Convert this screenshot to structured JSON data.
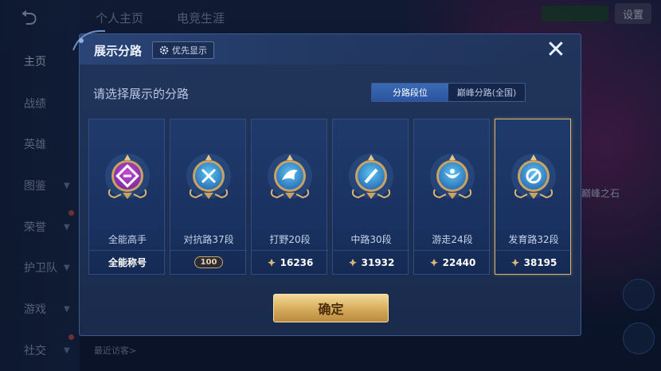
{
  "background": {
    "top_tabs": [
      "个人主页",
      "电竞生涯"
    ],
    "settings_label": "设置",
    "nav_items": [
      "主页",
      "战绩",
      "英雄",
      "图鉴",
      "荣誉",
      "护卫队",
      "游戏",
      "社交"
    ],
    "visitors_label": "最近访客>",
    "right_side_label": "巅峰之石"
  },
  "modal": {
    "title": "展示分路",
    "pref_button_label": "优先显示",
    "close_label": "✕",
    "prompt": "请选择展示的分路",
    "tabs": [
      {
        "label": "分路段位",
        "active": true
      },
      {
        "label": "巅峰分路(全国)",
        "active": false
      }
    ],
    "cards": [
      {
        "label": "全能高手",
        "footer": "全能称号",
        "footer_type": "text",
        "emblem": "all-round-icon",
        "colors": [
          "#c64bd8",
          "#7a2c9e"
        ]
      },
      {
        "label": "对抗路37段",
        "footer": "100",
        "footer_type": "badge",
        "emblem": "clash-lane-icon",
        "colors": [
          "#5fc3f0",
          "#2a71b8"
        ]
      },
      {
        "label": "打野20段",
        "footer": "16236",
        "footer_type": "points",
        "emblem": "jungle-icon",
        "colors": [
          "#5fc3f0",
          "#2a71b8"
        ]
      },
      {
        "label": "中路30段",
        "footer": "31932",
        "footer_type": "points",
        "emblem": "mid-lane-icon",
        "colors": [
          "#5fc3f0",
          "#2a71b8"
        ]
      },
      {
        "label": "游走24段",
        "footer": "22440",
        "footer_type": "points",
        "emblem": "roam-icon",
        "colors": [
          "#5fc3f0",
          "#2a71b8"
        ]
      },
      {
        "label": "发育路32段",
        "footer": "38195",
        "footer_type": "points",
        "emblem": "farm-lane-icon",
        "colors": [
          "#5fc3f0",
          "#2a71b8"
        ],
        "selected": true
      }
    ],
    "confirm_label": "确定"
  },
  "colors": {
    "accent_gold": "#d9b773",
    "tab_active": "#2f5ca6",
    "modal_bg": "#1f3257"
  }
}
